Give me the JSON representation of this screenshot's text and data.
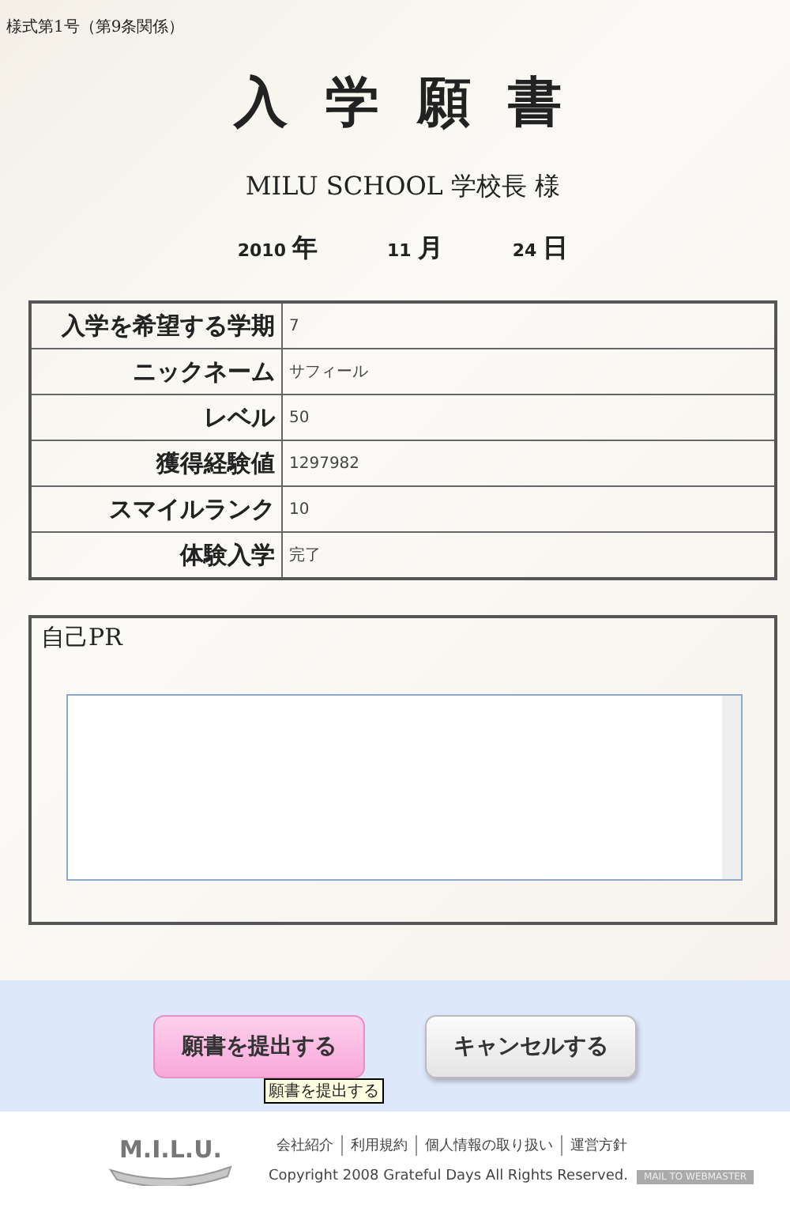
{
  "form_number": "様式第1号（第9条関係）",
  "title": "入 学 願 書",
  "addressee": "MILU SCHOOL 学校長 様",
  "date": [
    {
      "value": "2010",
      "unit": "年"
    },
    {
      "value": "11",
      "unit": "月"
    },
    {
      "value": "24",
      "unit": "日"
    }
  ],
  "fields": [
    {
      "label": "入学を希望する学期",
      "value": "7"
    },
    {
      "label": "ニックネーム",
      "value": "サフィール"
    },
    {
      "label": "レベル",
      "value": "50"
    },
    {
      "label": "獲得経験値",
      "value": "1297982"
    },
    {
      "label": "スマイルランク",
      "value": "10"
    },
    {
      "label": "体験入学",
      "value": "完了"
    }
  ],
  "self_pr": {
    "label": "自己PR"
  },
  "buttons": [
    {
      "label": "願書を提出する",
      "kind": "primary"
    },
    {
      "label": "キャンセルする",
      "kind": "secondary"
    }
  ],
  "tooltip": "願書を提出する",
  "footer": {
    "logo": "M.I.L.U.",
    "links": [
      "会社紹介",
      "利用規約",
      "個人情報の取り扱い",
      "運営方針"
    ],
    "copyright": "Copyright 2008 Grateful Days All Rights Reserved.",
    "mail_button": "MAIL TO WEBMASTER"
  }
}
